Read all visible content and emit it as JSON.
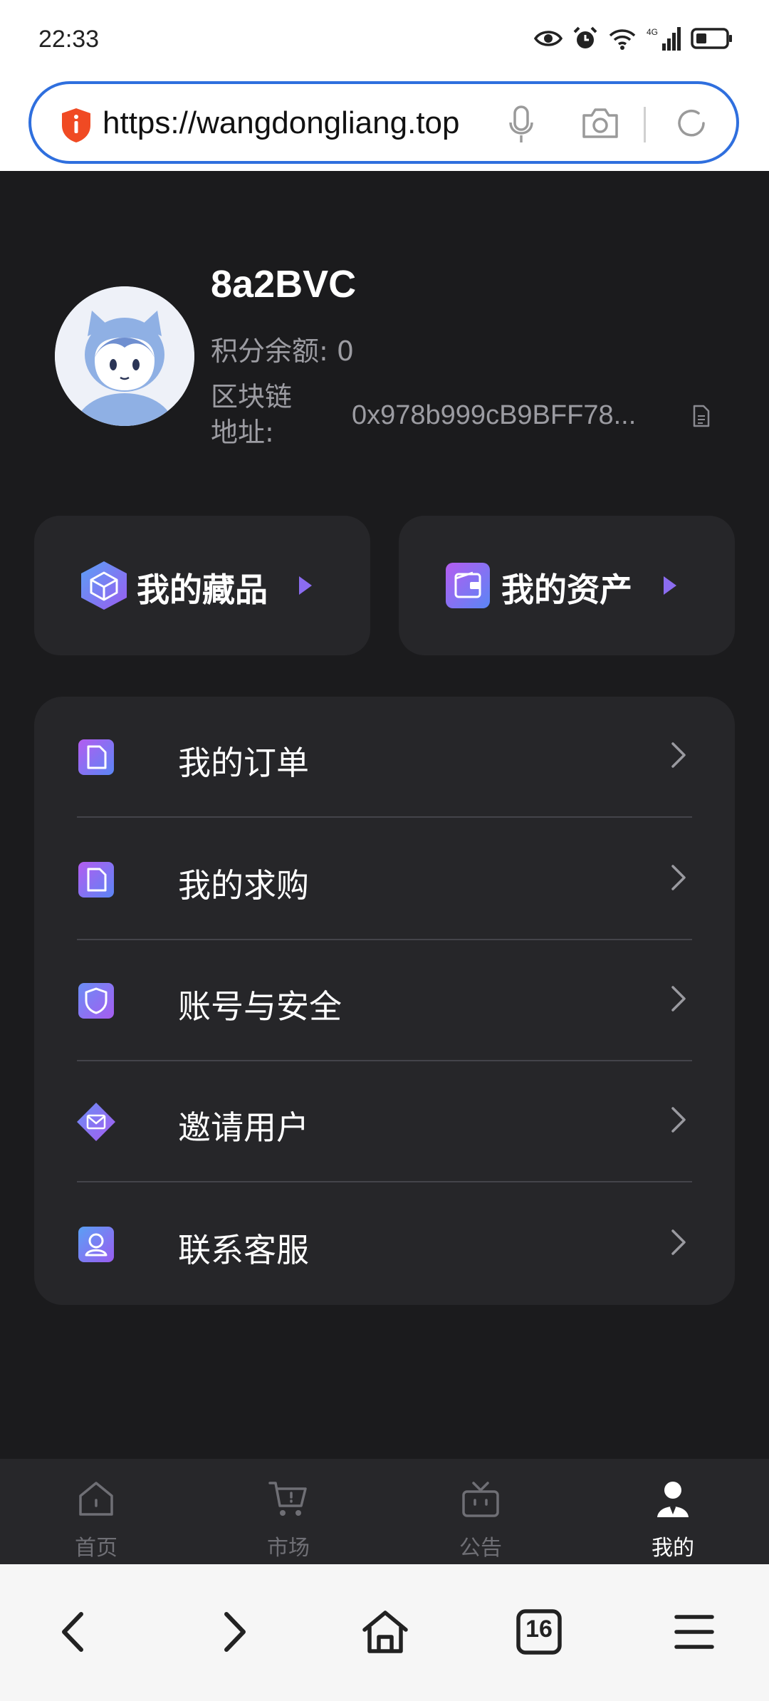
{
  "status_bar": {
    "time": "22:33",
    "icons": [
      "eye-icon",
      "alarm-icon",
      "wifi-icon",
      "signal-4g-icon",
      "battery-icon"
    ],
    "network": "4G"
  },
  "browser": {
    "url": "https://wangdongliang.top",
    "icons": [
      "security-shield-icon",
      "microphone-icon",
      "camera-icon",
      "reload-icon"
    ],
    "tab_count": "16"
  },
  "profile": {
    "username": "8a2BVC",
    "points_label": "积分余额:",
    "points_value": "0",
    "points_text": "积分余额: 0",
    "chain_label": "区块链地址:",
    "chain_address": "0x978b999cB9BFF78..."
  },
  "cards": [
    {
      "label": "我的藏品",
      "icon": "cube-icon"
    },
    {
      "label": "我的资产",
      "icon": "wallet-icon"
    }
  ],
  "menu": [
    {
      "label": "我的订单",
      "icon": "document-icon"
    },
    {
      "label": "我的求购",
      "icon": "document-icon"
    },
    {
      "label": "账号与安全",
      "icon": "shield-icon"
    },
    {
      "label": "邀请用户",
      "icon": "envelope-icon"
    },
    {
      "label": "联系客服",
      "icon": "customer-service-icon"
    }
  ],
  "tabs": [
    {
      "label": "首页",
      "icon": "home-icon",
      "active": false
    },
    {
      "label": "市场",
      "icon": "cart-icon",
      "active": false
    },
    {
      "label": "公告",
      "icon": "announcement-icon",
      "active": false
    },
    {
      "label": "我的",
      "icon": "user-icon",
      "active": true
    }
  ],
  "colors": {
    "background": "#1b1b1d",
    "card": "#262629",
    "accent": "#8b6cf0",
    "url_border": "#2f6fde",
    "inactive_tab": "#6f6f75"
  }
}
